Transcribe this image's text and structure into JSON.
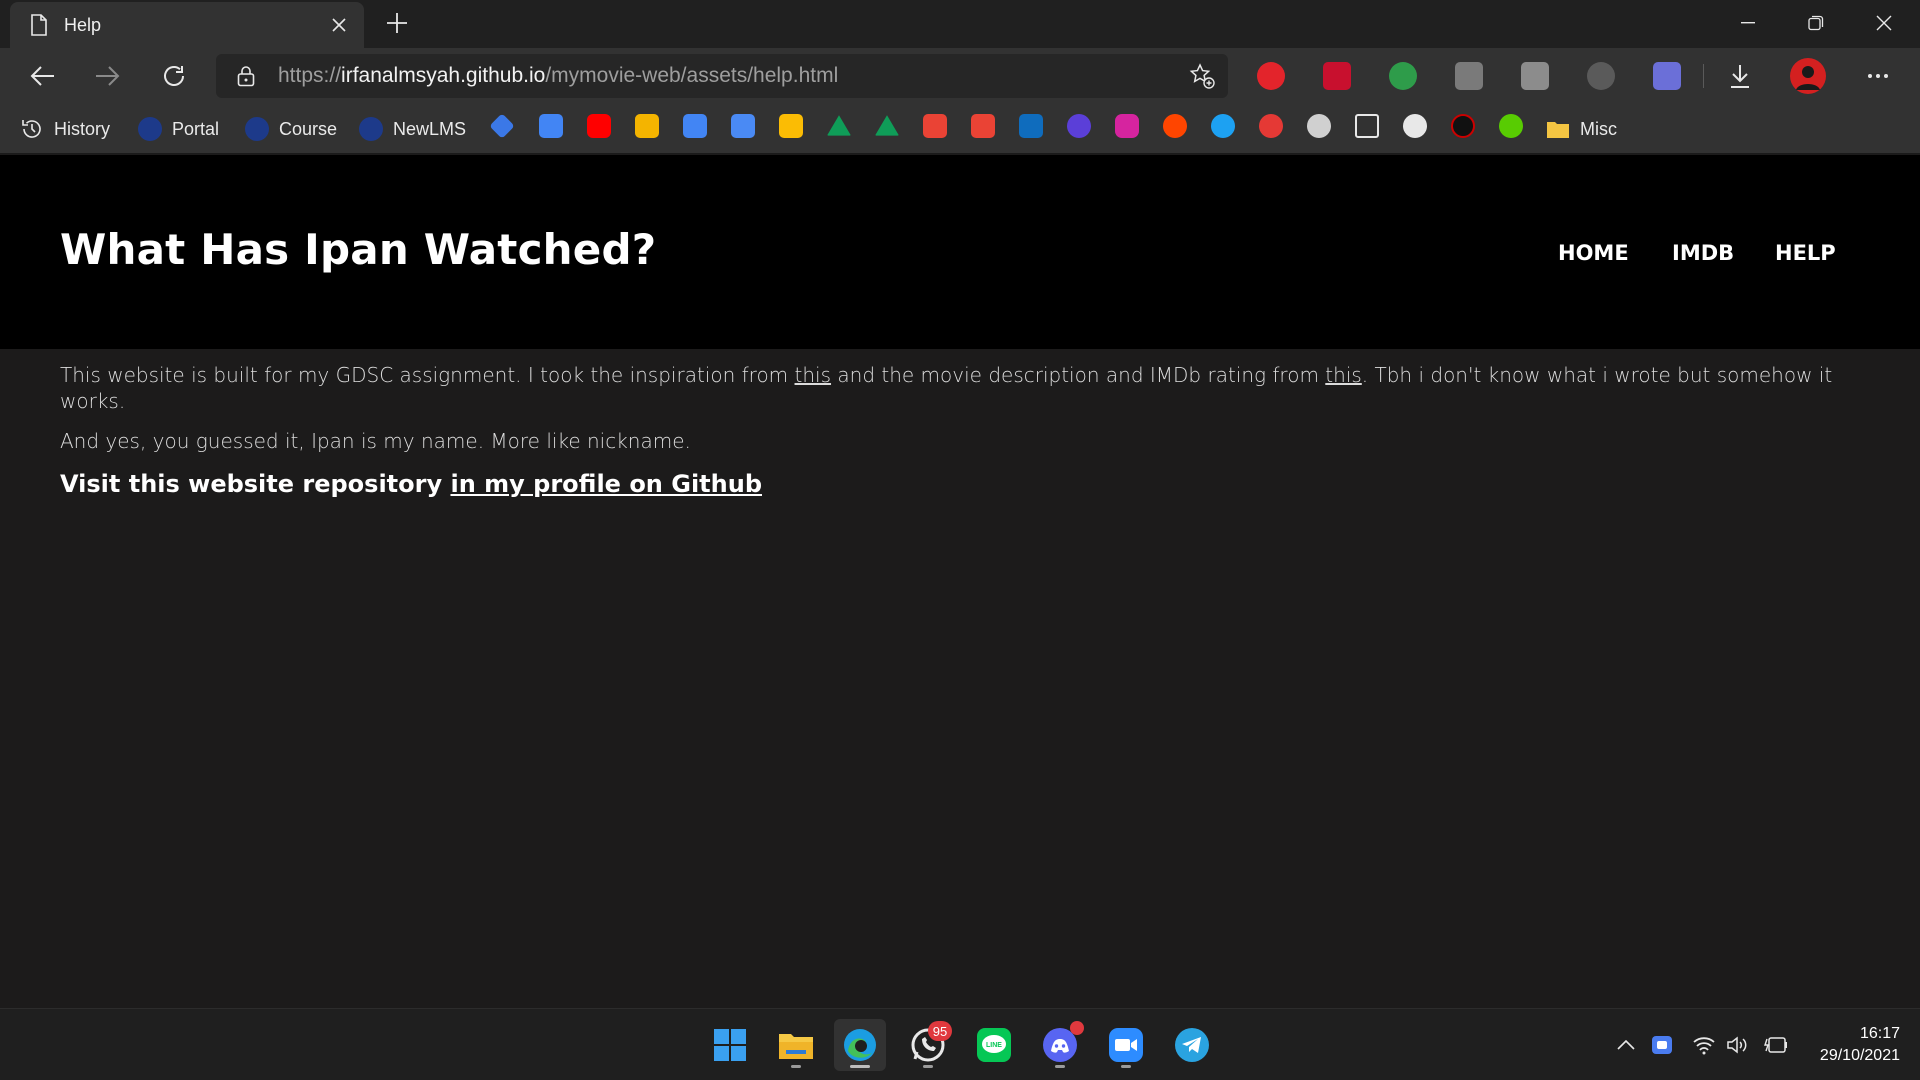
{
  "browser": {
    "tab": {
      "title": "Help"
    },
    "url": {
      "scheme": "https://",
      "host": "irfanalmsyah.github.io",
      "path": "/mymovie-web/assets/help.html"
    },
    "bookmarks": [
      {
        "label": "History",
        "icon": "history-icon"
      },
      {
        "label": "Portal",
        "icon": "ipb-logo-icon"
      },
      {
        "label": "Course",
        "icon": "ipb-logo-icon"
      },
      {
        "label": "NewLMS",
        "icon": "ipb-logo-icon"
      },
      {
        "label": "Misc",
        "icon": "folder-icon"
      }
    ]
  },
  "site": {
    "title": "What Has Ipan Watched?",
    "nav": {
      "home": "HOME",
      "imdb": "IMDB",
      "help": "HELP"
    }
  },
  "content": {
    "p1_a": "This website is built for my GDSC assignment. I took the inspiration from ",
    "p1_link1": "this",
    "p1_b": " and the movie description and IMDb rating from ",
    "p1_link2": "this",
    "p1_c": ". Tbh i don't know what i wrote but somehow it works.",
    "p2": "And yes, you guessed it, Ipan is my name. More like nickname.",
    "visit_text": "Visit this website repository ",
    "visit_link": "in my profile on Github"
  },
  "taskbar": {
    "whatsapp_badge": "95",
    "time": "16:17",
    "date": "29/10/2021"
  },
  "colors": {
    "header_bg": "#000000",
    "page_bg": "#1c1b1b",
    "chrome_bg": "#323232"
  }
}
